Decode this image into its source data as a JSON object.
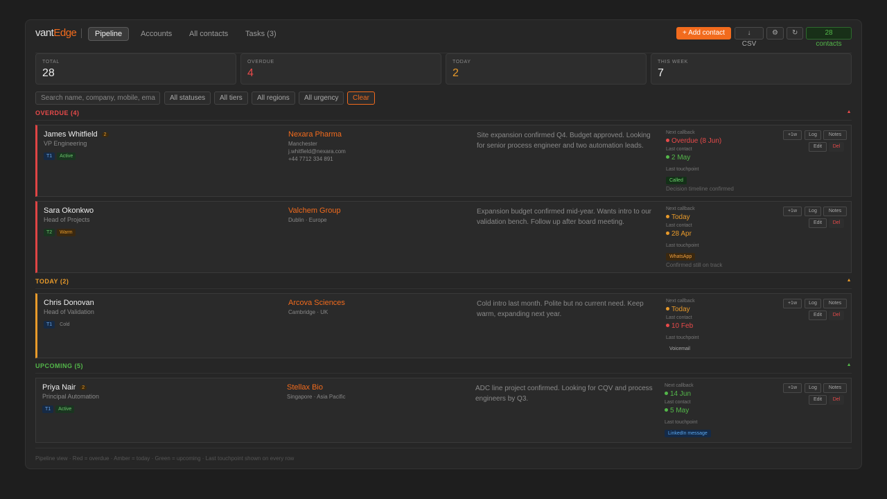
{
  "header": {
    "logo_part1": "vant",
    "logo_part2": "Edge",
    "tabs": [
      "Pipeline",
      "Accounts",
      "All contacts",
      "Tasks (3)"
    ],
    "add_contact": "+ Add contact",
    "csv": "↓ CSV",
    "settings_icon": "⚙",
    "refresh_icon": "↻",
    "contacts_count": "28 contacts"
  },
  "stats": [
    {
      "label": "TOTAL",
      "value": "28"
    },
    {
      "label": "OVERDUE",
      "value": "4"
    },
    {
      "label": "TODAY",
      "value": "2"
    },
    {
      "label": "THIS WEEK",
      "value": "7"
    }
  ],
  "filters": {
    "search_placeholder": "Search name, company, mobile, ema",
    "statuses": "All statuses",
    "tiers": "All tiers",
    "regions": "All regions",
    "urgency": "All urgency",
    "clear": "Clear"
  },
  "sections": {
    "overdue": "OVERDUE (4)",
    "today": "TODAY (2)",
    "upcoming": "UPCOMING (5)",
    "caret": "▲"
  },
  "labels": {
    "next_callback": "Next callback",
    "last_contact": "Last contact",
    "last_touchpoint": "Last touchpoint",
    "plus_week": "+1w",
    "log": "Log",
    "notes": "Notes",
    "edit": "Edit",
    "del": "Del"
  },
  "contacts": [
    {
      "name": "James Whitfield",
      "badge": "2",
      "role": "VP Engineering",
      "tier": "T1",
      "status": "Active",
      "company": "Nexara Pharma",
      "location": "Manchester",
      "email": "j.whitfield@nexara.com",
      "phone": "+44 7712 334 891",
      "note": "Site expansion confirmed Q4. Budget approved. Looking for senior process engineer and two automation leads.",
      "next_callback": "Overdue (8 Jun)",
      "last_contact": "2 May",
      "touchpoint": "Called",
      "touchpoint_note": "Decision timeline confirmed"
    },
    {
      "name": "Sara Okonkwo",
      "role": "Head of Projects",
      "tier": "T2",
      "status": "Warm",
      "company": "Valchem Group",
      "location": "Dublin · Europe",
      "note": "Expansion budget confirmed mid-year. Wants intro to our validation bench. Follow up after board meeting.",
      "next_callback": "Today",
      "last_contact": "28 Apr",
      "touchpoint": "WhatsApp",
      "touchpoint_note": "Confirmed still on track"
    },
    {
      "name": "Chris Donovan",
      "role": "Head of Validation",
      "tier": "T1",
      "status": "Cold",
      "company": "Arcova Sciences",
      "location": "Cambridge · UK",
      "note": "Cold intro last month. Polite but no current need. Keep warm, expanding next year.",
      "next_callback": "Today",
      "last_contact": "10 Feb",
      "touchpoint": "Voicemail"
    },
    {
      "name": "Priya Nair",
      "badge": "2",
      "role": "Principal Automation",
      "tier": "T1",
      "status": "Active",
      "company": "Stellax Bio",
      "location": "Singapore · Asia Pacific",
      "note": "ADC line project confirmed. Looking for CQV and process engineers by Q3.",
      "next_callback": "14 Jun",
      "last_contact": "5 May",
      "touchpoint": "LinkedIn message"
    }
  ],
  "footer": "Pipeline view  ·  Red = overdue  ·  Amber = today  ·  Green = upcoming  ·  Last touchpoint shown on every row",
  "colors": {
    "accent": "#f26b1d",
    "overdue": "#e84a4a",
    "today": "#e89a2a",
    "upcoming": "#54b84a",
    "background": "#1e1e1e"
  }
}
